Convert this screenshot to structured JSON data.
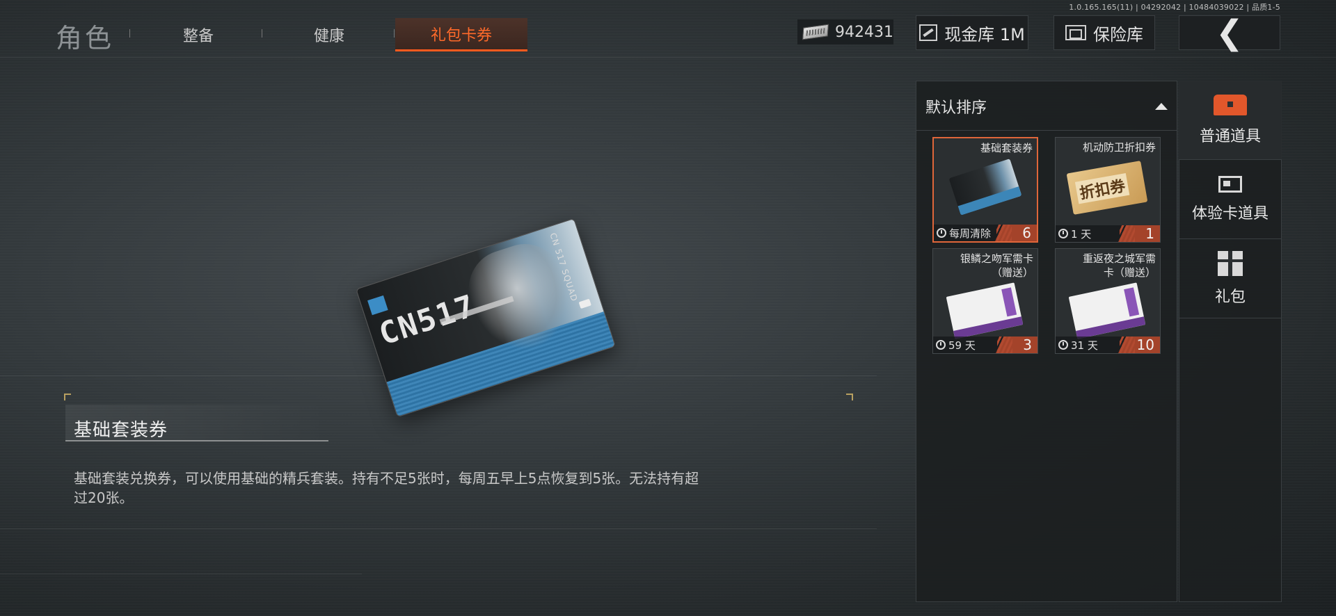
{
  "version": "1.0.165.165(11) | 04292042 | 10484039022 | 品质1-5",
  "nav": {
    "title": "角色",
    "tabs": [
      {
        "label": "整备"
      },
      {
        "label": "健康"
      },
      {
        "label": "礼包卡券"
      }
    ],
    "active_tab": "礼包卡券"
  },
  "topbar": {
    "currency_value": "942431",
    "cash_vault_label": "现金库 1M",
    "safe_label": "保险库"
  },
  "featured_item": {
    "card_logo": "CN517",
    "card_vertical_text": "CN 517 SQUAD"
  },
  "description": {
    "title": "基础套装券",
    "text": "基础套装兑换券，可以使用基础的精兵套装。持有不足5张时，每周五早上5点恢复到5张。无法持有超过20张。"
  },
  "inventory": {
    "sort_label": "默认排序",
    "items": [
      {
        "name": "基础套装券",
        "time": "每周清除",
        "count": "6",
        "selected": true
      },
      {
        "name": "机动防卫折扣券",
        "time": "1 天",
        "count": "1",
        "thumb_text": "折扣券"
      },
      {
        "name": "银鳞之吻军需卡\n（赠送）",
        "time": "59 天",
        "count": "3"
      },
      {
        "name": "重返夜之城军需\n卡（赠送）",
        "time": "31 天",
        "count": "10"
      }
    ]
  },
  "categories": [
    {
      "label": "普通道具",
      "icon": "chest-icon",
      "active": true
    },
    {
      "label": "体验卡道具",
      "icon": "trial-card-icon"
    },
    {
      "label": "礼包",
      "icon": "gift-icon"
    }
  ],
  "colors": {
    "accent": "#ff5a1e",
    "count_badge": "#a4432a",
    "chest_icon": "#e2572b"
  }
}
